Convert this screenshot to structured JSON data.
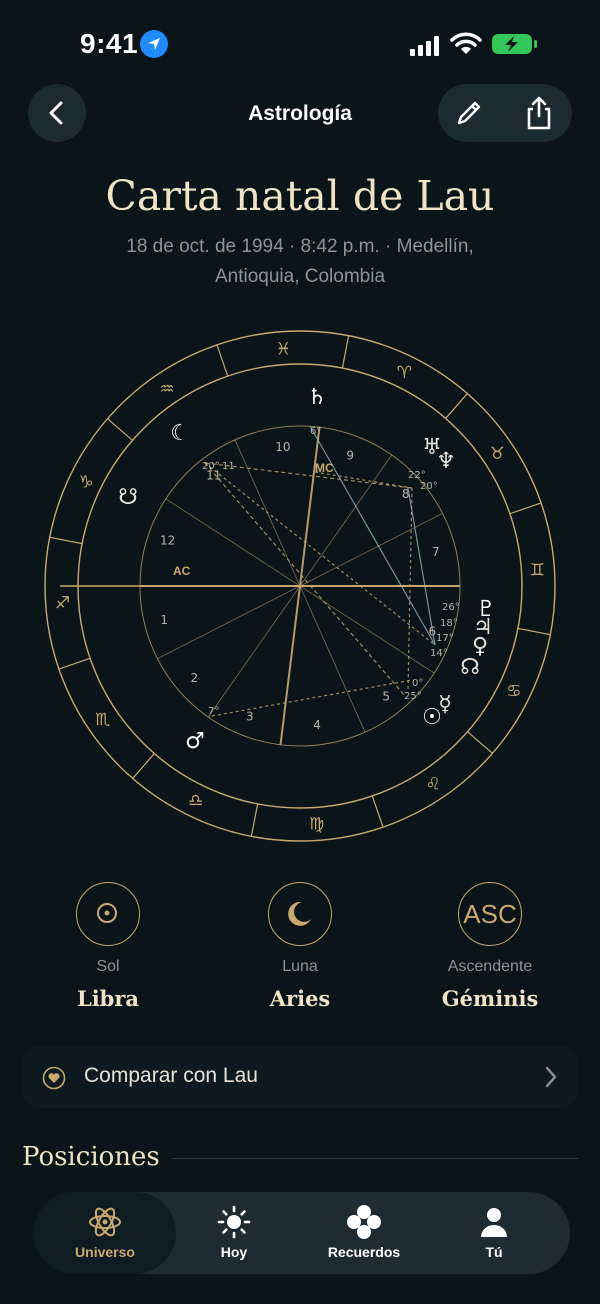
{
  "status": {
    "time": "9:41"
  },
  "nav": {
    "title": "Astrología"
  },
  "header": {
    "title": "Carta natal de Lau",
    "subtitle_line1": "18 de oct. de 1994 · 8:42 p.m. · Medellín,",
    "subtitle_line2": "Antioquia, Colombia"
  },
  "wheel": {
    "signs": [
      "♓",
      "♒",
      "♑",
      "♐",
      "♏",
      "♎",
      "♍",
      "♌",
      "♋",
      "♊",
      "♉",
      "♈"
    ],
    "houses": [
      "1",
      "2",
      "3",
      "4",
      "5",
      "6",
      "7",
      "8",
      "9",
      "10",
      "11",
      "12"
    ],
    "labels": {
      "ac": "AC",
      "mc": "MC"
    },
    "planets": {
      "moon": "☾",
      "saturn": "♄",
      "uranus": "♅",
      "neptune": "♆",
      "pluto": "♇",
      "jupiter": "♃",
      "node_n": "☊",
      "node_s": "☋",
      "venus": "♀",
      "mercury": "☿",
      "sun": "☉",
      "mars": "♂"
    },
    "degrees": [
      "6°",
      "20°",
      "11",
      "22°",
      "20°",
      "26°",
      "18°",
      "17°",
      "14°",
      "0°",
      "25°",
      "7°"
    ]
  },
  "big_three": [
    {
      "label": "Sol",
      "value": "Libra",
      "icon": "sun-icon"
    },
    {
      "label": "Luna",
      "value": "Aries",
      "icon": "moon-icon"
    },
    {
      "label": "Ascendente",
      "value": "Géminis",
      "icon": "ASC"
    }
  ],
  "compare": {
    "label": "Comparar con Lau"
  },
  "positions": {
    "title": "Posiciones"
  },
  "tabs": [
    {
      "label": "Universo",
      "icon": "atom-icon"
    },
    {
      "label": "Hoy",
      "icon": "sun-icon"
    },
    {
      "label": "Recuerdos",
      "icon": "clover-icon"
    },
    {
      "label": "Tú",
      "icon": "person-icon"
    }
  ],
  "colors": {
    "accent": "#c9a96e",
    "bg": "#0a1419"
  }
}
